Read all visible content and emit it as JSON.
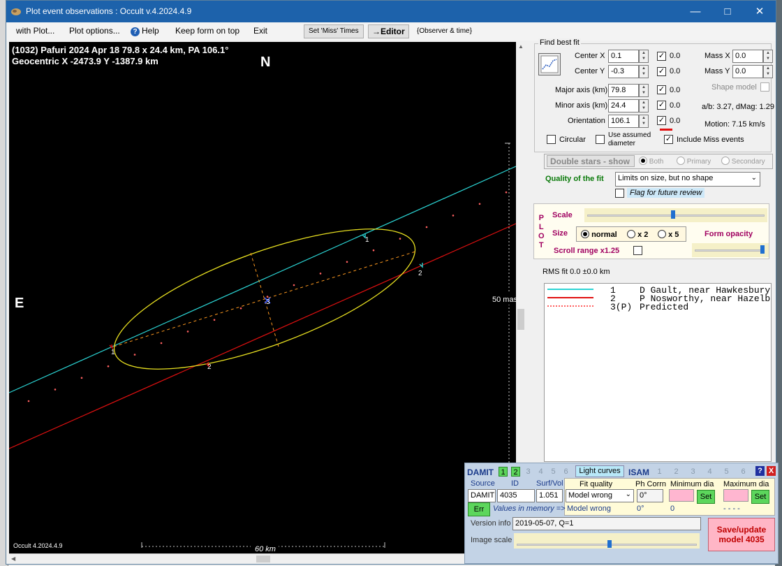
{
  "window": {
    "title": "Plot event observations : Occult v.4.2024.4.9"
  },
  "menu": {
    "with_plot": "with Plot...",
    "plot_options": "Plot options...",
    "help": "Help",
    "keep_on_top": "Keep form on top",
    "exit": "Exit",
    "set_miss_times": "Set 'Miss' Times",
    "editor": "→Editor",
    "observer_time": "{Observer & time}"
  },
  "plot": {
    "header_line1": "(1032) Pafuri  2024 Apr 18   79.8 x 24.4 km, PA 106.1°",
    "header_line2": "Geocentric  X  -2473.9  Y -1387.9 km",
    "north": "N",
    "east": "E",
    "scale_mas": "50 mas",
    "scale_km": "60 km",
    "footer": "Occult 4.2024.4.9",
    "chord_labels": {
      "cyan_top": "1",
      "cyan_bottom": "1",
      "red_top": "2",
      "red_bottom": "2",
      "center": "3"
    },
    "colors": {
      "chord1": "#2bd4d4",
      "chord2": "#e01010",
      "ellipse": "#e8e020",
      "axis": "#ff9a20",
      "predicted": "#ff6060"
    }
  },
  "fit": {
    "section": "Find best fit",
    "center_x_label": "Center X",
    "center_x": "0.1",
    "center_x_d": "0.0",
    "center_y_label": "Center Y",
    "center_y": "-0.3",
    "center_y_d": "0.0",
    "major_label": "Major axis (km)",
    "major": "79.8",
    "major_d": "0.0",
    "minor_label": "Minor axis (km)",
    "minor": "24.4",
    "minor_d": "0.0",
    "orient_label": "Orientation",
    "orient": "106.1",
    "orient_d": "0.0",
    "mass_x_label": "Mass X",
    "mass_x": "0.0",
    "mass_y_label": "Mass Y",
    "mass_y": "0.0",
    "shape_model": "Shape model",
    "ab_dmag": "a/b: 3.27, dMag: 1.29",
    "motion": "Motion: 7.15 km/s",
    "circular": "Circular",
    "use_assumed": "Use assumed",
    "diameter": "diameter",
    "include_miss": "Include Miss events",
    "double_stars": "Double stars - show",
    "both": "Both",
    "primary": "Primary",
    "secondary": "Secondary",
    "quality_label": "Quality of the fit",
    "quality_value": "Limits on size, but no shape",
    "flag_review": "Flag for future review"
  },
  "plotbox": {
    "p": "P",
    "l": "L",
    "o": "O",
    "t": "T",
    "scale": "Scale",
    "size": "Size",
    "normal": "normal",
    "x2": "x 2",
    "x5": "x 5",
    "form_opacity": "Form opacity",
    "scroll_range": "Scroll range x1.25",
    "rms": "RMS fit  0.0 ±0.0 km"
  },
  "legend": [
    {
      "num": "1",
      "name": "D Gault, near Hawkesbury",
      "color": "#2bd4d4"
    },
    {
      "num": "2",
      "name": "P Nosworthy, near Hazelbrook",
      "color": "#e01010"
    },
    {
      "num": "3(P)",
      "name": "Predicted",
      "color": "#ff6060"
    }
  ],
  "damit": {
    "damit": "DAMIT",
    "isam": "ISAM",
    "nums": [
      "1",
      "2",
      "3",
      "4",
      "5",
      "6"
    ],
    "light_curves": "Light curves",
    "help_q": "?",
    "close_x": "X",
    "source_label": "Source",
    "id_label": "ID",
    "surf_label": "Surf/Vol",
    "source": "DAMIT",
    "id": "4035",
    "surf": "1.051",
    "fit_quality_label": "Fit quality",
    "ph_corrn_label": "Ph Corrn",
    "min_dia_label": "Minimum dia",
    "max_dia_label": "Maximum dia",
    "fit_quality": "Model wrong",
    "ph_corrn": "0°",
    "set": "Set",
    "err": "Err",
    "values_memory": "Values in memory =>",
    "mem_fit": "Model wrong",
    "mem_ph": "0°",
    "mem_min": "0",
    "mem_max": "- - - -",
    "version_label": "Version info",
    "version": "2019-05-07, Q=1",
    "image_scale": "Image scale",
    "save_line1": "Save/update",
    "save_line2": "model 4035"
  }
}
